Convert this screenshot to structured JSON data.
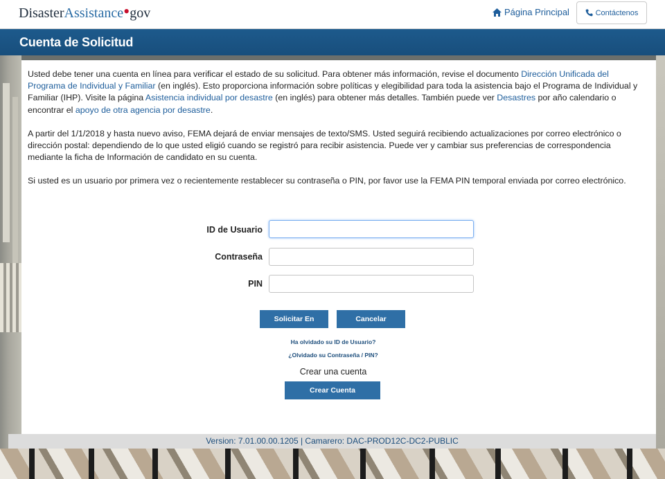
{
  "header": {
    "logo": {
      "part1": "Disaster",
      "part2": "Assistance",
      "dot": "•",
      "part3": "gov"
    },
    "home_link": "Página Principal",
    "home_icon": "home-icon",
    "contact_button": "Contáctenos",
    "contact_icon": "phone-icon"
  },
  "titlebar": {
    "title": "Cuenta de Solicitud"
  },
  "intro": {
    "p1": {
      "t1": "Usted debe tener una cuenta en línea para verificar el estado de su solicitud. Para obtener más información, revise el documento ",
      "link1": "Dirección Unificada del Programa de Individual y Familiar",
      "t2": " (en inglés). Esto proporciona información sobre políticas y elegibilidad para toda la asistencia bajo el Programa de Individual y Familiar (IHP). Visite la página ",
      "link2": "Asistencia individual por desastre",
      "t3": " (en inglés) para obtener más detalles. También puede ver ",
      "link3": "Desastres",
      "t4": " por año calendario o encontrar el ",
      "link4": "apoyo de otra agencia por desastre",
      "t5": "."
    },
    "p2": "A partir del 1/1/2018 y hasta nuevo aviso, FEMA dejará de enviar mensajes de texto/SMS. Usted seguirá recibiendo actualizaciones por correo electrónico o dirección postal: dependiendo de lo que usted eligió cuando se registró para recibir asistencia. Puede ver y cambiar sus preferencias de correspondencia mediante la ficha de Información de candidato en su cuenta.",
    "p3": "Si usted es un usuario por primera vez o recientemente restablecer su contraseña o PIN, por favor use la FEMA PIN temporal enviada por correo electrónico."
  },
  "form": {
    "user_id_label": "ID de Usuario",
    "user_id_value": "",
    "password_label": "Contraseña",
    "password_value": "",
    "pin_label": "PIN",
    "pin_value": "",
    "submit_button": "Solicitar En",
    "cancel_button": "Cancelar",
    "forgot_user_id": "Ha olvidado su ID de Usuario?",
    "forgot_password": "¿Olvidado su Contraseña / PIN?",
    "create_label": "Crear una cuenta",
    "create_button": "Crear Cuenta"
  },
  "footer": {
    "text": "Version: 7.01.00.00.1205  |  Camarero: DAC-PROD12C-DC2-PUBLIC"
  },
  "colors": {
    "brand_blue": "#1d5a8c",
    "button_blue": "#2f6fa6",
    "logo_red": "#c7102e",
    "link_blue": "#1d5d9b"
  }
}
